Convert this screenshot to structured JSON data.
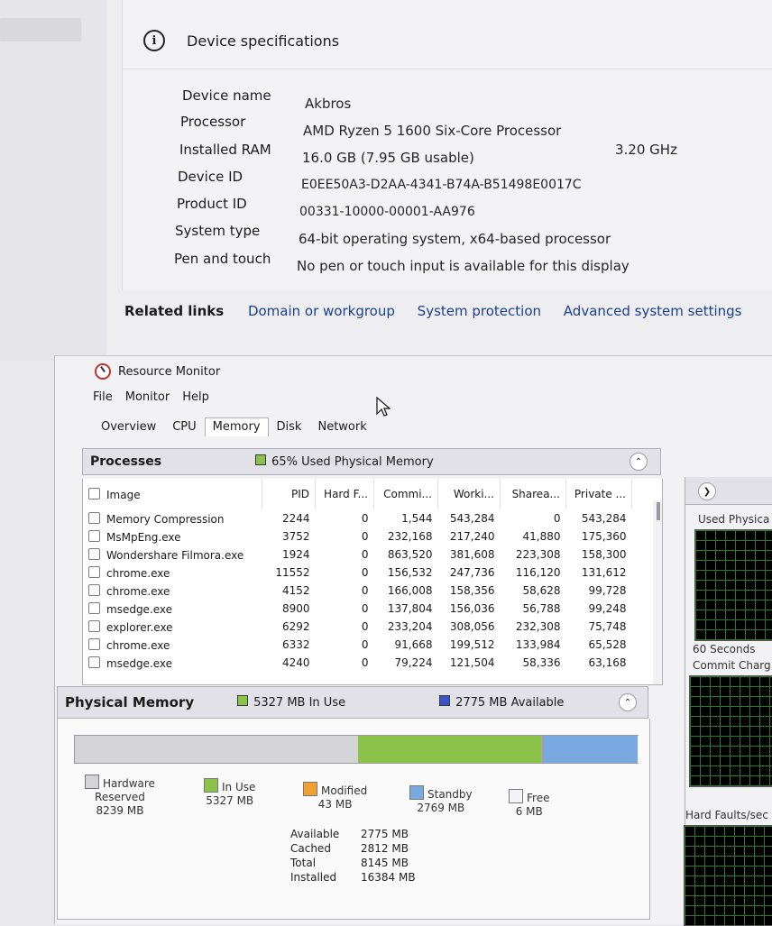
{
  "settings": {
    "section_title": "Device specifications",
    "specs": [
      {
        "label": "Device name",
        "value": "Akbros"
      },
      {
        "label": "Processor",
        "value": "AMD Ryzen 5 1600 Six-Core Processor",
        "extra": "3.20 GHz"
      },
      {
        "label": "Installed RAM",
        "value": "16.0 GB (7.95 GB usable)"
      },
      {
        "label": "Device ID",
        "value": "E0EE50A3-D2AA-4341-B74A-B51498E0017C"
      },
      {
        "label": "Product ID",
        "value": "00331-10000-00001-AA976"
      },
      {
        "label": "System type",
        "value": "64-bit operating system, x64-based processor"
      },
      {
        "label": "Pen and touch",
        "value": "No pen or touch input is available for this display"
      }
    ],
    "related_title": "Related links",
    "related_links": [
      "Domain or workgroup",
      "System protection",
      "Advanced system settings"
    ]
  },
  "resmon": {
    "title": "Resource Monitor",
    "menu": [
      "File",
      "Monitor",
      "Help"
    ],
    "tabs": [
      "Overview",
      "CPU",
      "Memory",
      "Disk",
      "Network"
    ],
    "active_tab": "Memory",
    "processes": {
      "title": "Processes",
      "status": "65% Used Physical Memory",
      "columns": [
        "Image",
        "PID",
        "Hard F...",
        "Commi...",
        "Worki...",
        "Sharea...",
        "Private ..."
      ],
      "rows": [
        [
          "Memory Compression",
          "2244",
          "0",
          "1,544",
          "543,284",
          "0",
          "543,284"
        ],
        [
          "MsMpEng.exe",
          "3752",
          "0",
          "232,168",
          "217,240",
          "41,880",
          "175,360"
        ],
        [
          "Wondershare Filmora.exe",
          "1924",
          "0",
          "863,520",
          "381,608",
          "223,308",
          "158,300"
        ],
        [
          "chrome.exe",
          "11552",
          "0",
          "156,532",
          "247,736",
          "116,120",
          "131,612"
        ],
        [
          "chrome.exe",
          "4152",
          "0",
          "166,008",
          "158,356",
          "58,628",
          "99,728"
        ],
        [
          "msedge.exe",
          "8900",
          "0",
          "137,804",
          "156,036",
          "56,788",
          "99,248"
        ],
        [
          "explorer.exe",
          "6292",
          "0",
          "233,204",
          "308,056",
          "232,308",
          "75,748"
        ],
        [
          "chrome.exe",
          "6332",
          "0",
          "91,668",
          "199,512",
          "133,984",
          "65,528"
        ],
        [
          "msedge.exe",
          "4240",
          "0",
          "79,224",
          "121,504",
          "58,336",
          "63,168"
        ]
      ]
    },
    "physical_memory": {
      "title": "Physical Memory",
      "in_use_label": "5327 MB In Use",
      "available_label": "2775 MB Available",
      "bar": {
        "hardware_reserved_mb": 8239,
        "in_use_mb": 5327,
        "modified_mb": 43,
        "standby_mb": 2769,
        "free_mb": 6
      },
      "legend": [
        {
          "name": "Hardware\nReserved",
          "value": "8239 MB",
          "color": "#d4d4d8"
        },
        {
          "name": "In Use",
          "value": "5327 MB",
          "color": "#8bc34a"
        },
        {
          "name": "Modified",
          "value": "43 MB",
          "color": "#f0a030"
        },
        {
          "name": "Standby",
          "value": "2769 MB",
          "color": "#7aa8e0"
        },
        {
          "name": "Free",
          "value": "6 MB",
          "color": "#f4f4f8"
        }
      ],
      "totals": [
        {
          "label": "Available",
          "value": "2775 MB"
        },
        {
          "label": "Cached",
          "value": "2812 MB"
        },
        {
          "label": "Total",
          "value": "8145 MB"
        },
        {
          "label": "Installed",
          "value": "16384 MB"
        }
      ]
    },
    "graphs": {
      "used_physical": "Used Physica",
      "seconds": "60 Seconds",
      "commit": "Commit Charg",
      "hard_faults": "Hard Faults/sec"
    }
  },
  "colors": {
    "link": "#1a3f8f",
    "in_use": "#8bc34a",
    "standby": "#7aa8e0",
    "reserved": "#d4d4d8"
  }
}
